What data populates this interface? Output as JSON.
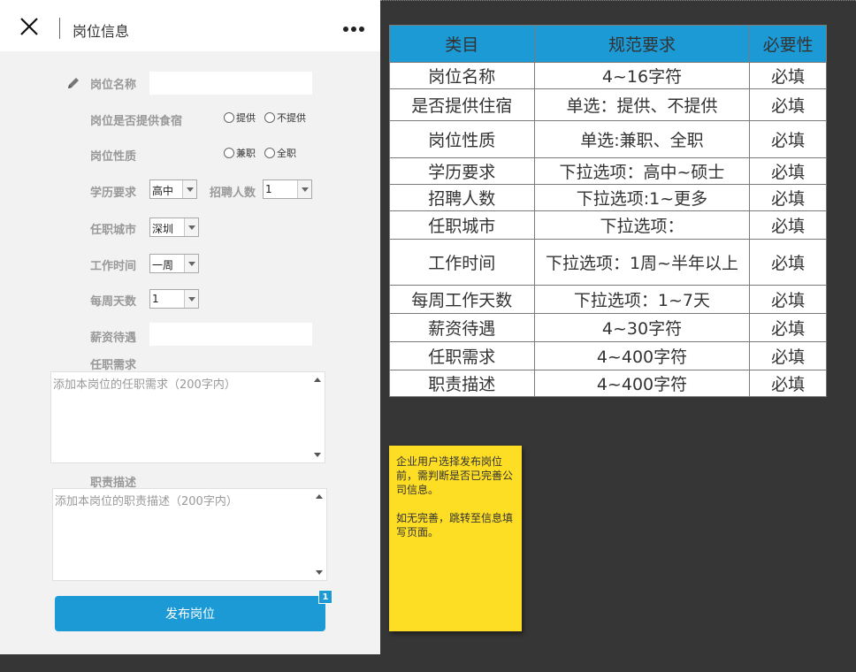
{
  "header": {
    "title": "岗位信息"
  },
  "form": {
    "job_name": {
      "label": "岗位名称",
      "value": ""
    },
    "accommodation": {
      "label": "岗位是否提供食宿",
      "options": [
        "提供",
        "不提供"
      ]
    },
    "job_type": {
      "label": "岗位性质",
      "options": [
        "兼职",
        "全职"
      ]
    },
    "education": {
      "label": "学历要求",
      "value": "高中"
    },
    "headcount": {
      "label": "招聘人数",
      "value": "1"
    },
    "city": {
      "label": "任职城市",
      "value": "深圳"
    },
    "work_time": {
      "label": "工作时间",
      "value": "一周"
    },
    "days_per_week": {
      "label": "每周天数",
      "value": "1"
    },
    "salary": {
      "label": "薪资待遇",
      "value": ""
    },
    "requirements": {
      "label": "任职需求",
      "placeholder": "添加本岗位的任职需求（200字内）"
    },
    "duties": {
      "label": "职责描述",
      "placeholder": "添加本岗位的职责描述（200字内）"
    },
    "publish_label": "发布岗位",
    "badge": "1"
  },
  "spec_table": {
    "headers": [
      "类目",
      "规范要求",
      "必要性"
    ],
    "rows": [
      [
        "岗位名称",
        "4~16字符",
        "必填"
      ],
      [
        "是否提供住宿",
        "单选：提供、不提供",
        "必填"
      ],
      [
        "岗位性质",
        "单选:兼职、全职",
        "必填"
      ],
      [
        "学历要求",
        "下拉选项：高中~硕士",
        "必填"
      ],
      [
        "招聘人数",
        "下拉选项:1~更多",
        "必填"
      ],
      [
        "任职城市",
        "下拉选项：",
        "必填"
      ],
      [
        "工作时间",
        "下拉选项：1周~半年以上",
        "必填"
      ],
      [
        "每周工作天数",
        "下拉选项：1~7天",
        "必填"
      ],
      [
        "薪资待遇",
        "4~30字符",
        "必填"
      ],
      [
        "任职需求",
        "4~400字符",
        "必填"
      ],
      [
        "职责描述",
        "4~400字符",
        "必填"
      ]
    ]
  },
  "note": {
    "para1": "企业用户选择发布岗位前，需判断是否已完善公司信息。",
    "para2": "如无完善，跳转至信息填写页面。"
  },
  "colors": {
    "accent": "#1b9ad6",
    "note_bg": "#fdde24",
    "canvas": "#363636"
  }
}
